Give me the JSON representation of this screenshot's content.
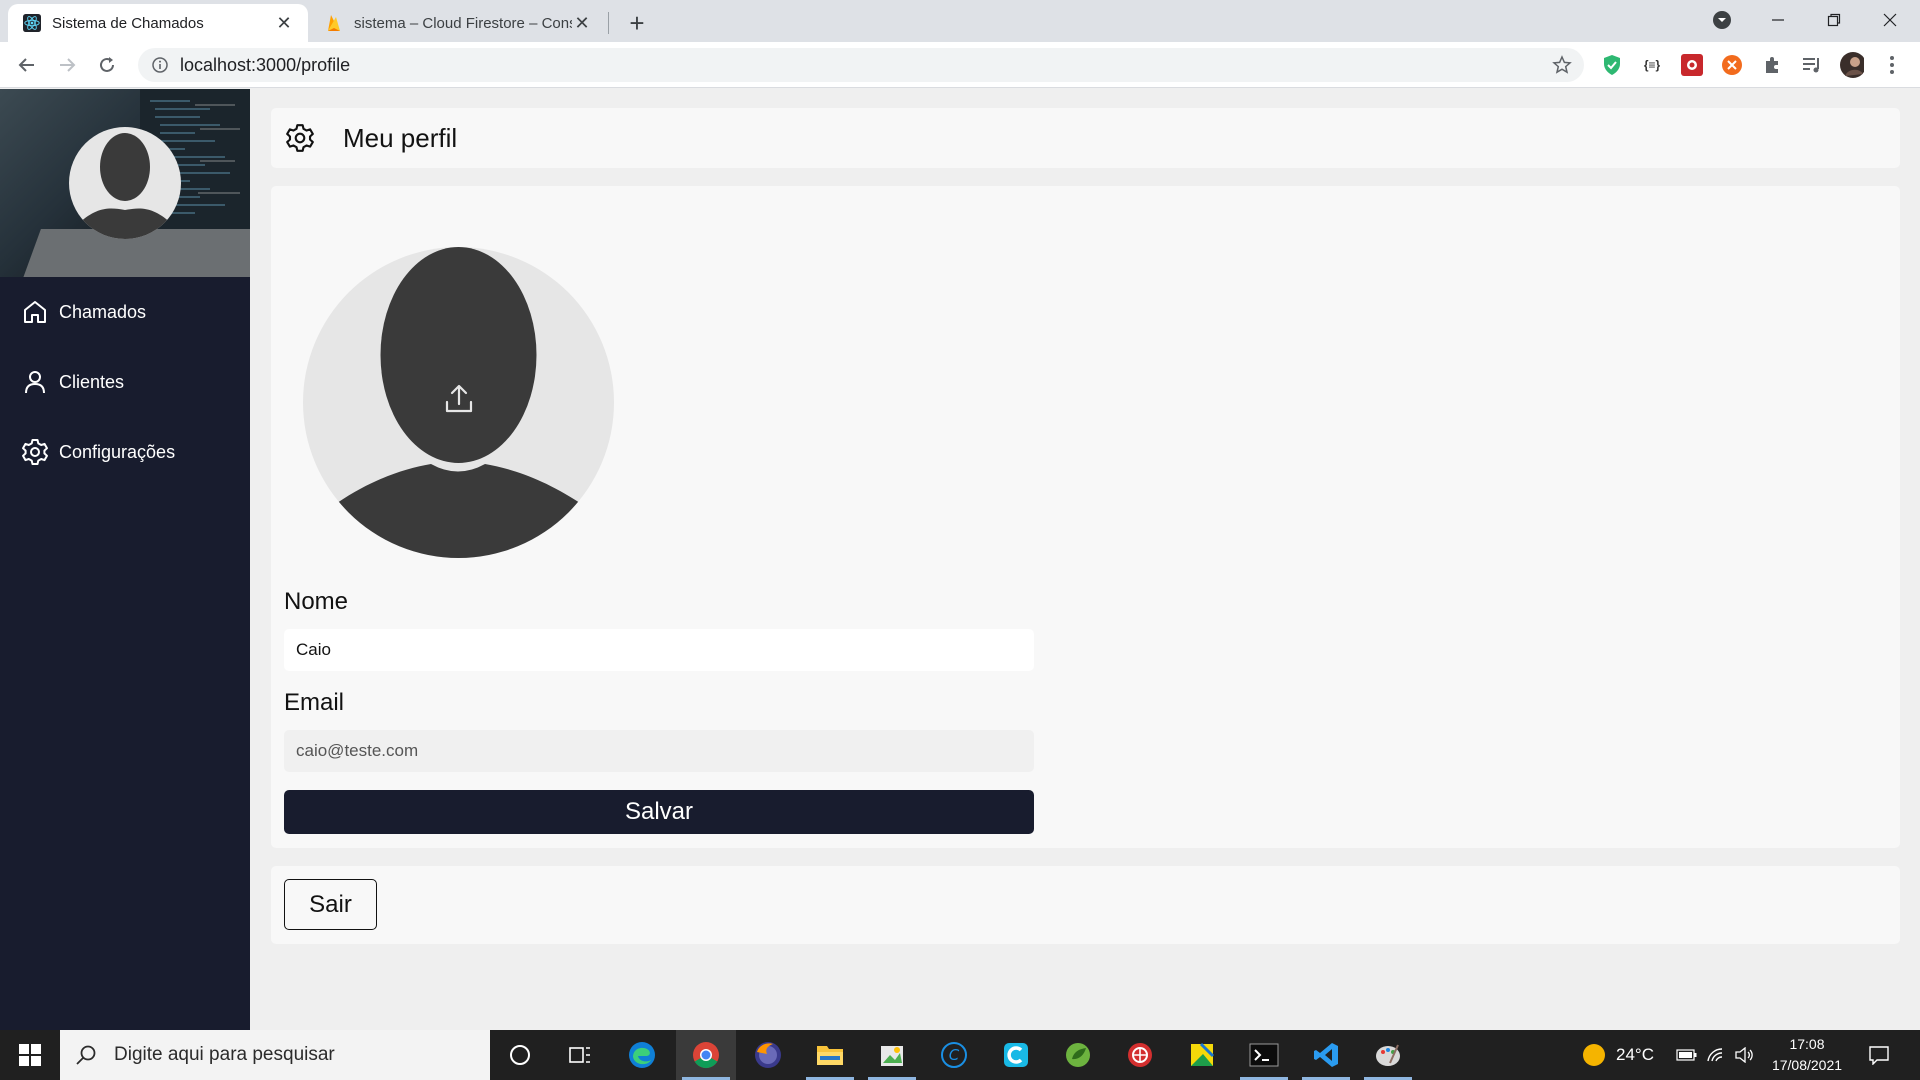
{
  "browser": {
    "tabs": [
      {
        "title": "Sistema de Chamados",
        "active": true,
        "icon": "react-icon"
      },
      {
        "title": "sistema – Cloud Firestore – Consc",
        "active": false,
        "icon": "firebase-icon"
      }
    ],
    "address": "localhost:3000/profile"
  },
  "sidebar": {
    "items": [
      {
        "label": "Chamados",
        "icon": "home-icon"
      },
      {
        "label": "Clientes",
        "icon": "user-icon"
      },
      {
        "label": "Configurações",
        "icon": "gear-icon"
      }
    ]
  },
  "page": {
    "title": "Meu perfil",
    "title_icon": "gear-icon"
  },
  "profile_form": {
    "name_label": "Nome",
    "name_value": "Caio",
    "email_label": "Email",
    "email_value": "caio@teste.com",
    "save_label": "Salvar"
  },
  "logout": {
    "label": "Sair"
  },
  "taskbar": {
    "search_placeholder": "Digite aqui para pesquisar",
    "temperature": "24°C",
    "time": "17:08",
    "date": "17/08/2021"
  },
  "colors": {
    "sidebar_bg": "#181c2e",
    "button_bg": "#181c2e",
    "card_bg": "#f8f8f8",
    "page_bg": "#efefef"
  }
}
